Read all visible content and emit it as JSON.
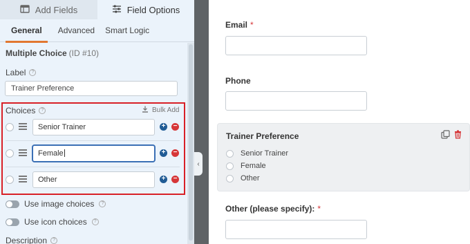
{
  "top_tabs": [
    {
      "label": "Add Fields",
      "icon": "table-icon",
      "active": false
    },
    {
      "label": "Field Options",
      "icon": "sliders-icon",
      "active": true
    }
  ],
  "sub_tabs": [
    {
      "label": "General",
      "active": true
    },
    {
      "label": "Advanced",
      "active": false
    },
    {
      "label": "Smart Logic",
      "active": false
    }
  ],
  "field": {
    "type_name": "Multiple Choice",
    "id_text": "(ID #10)"
  },
  "label_section": {
    "label": "Label",
    "value": "Trainer Preference"
  },
  "choices_section": {
    "label": "Choices",
    "bulk_add": "Bulk Add",
    "items": [
      {
        "value": "Senior Trainer",
        "focused": false
      },
      {
        "value": "Female",
        "focused": true
      },
      {
        "value": "Other",
        "focused": false
      }
    ]
  },
  "toggles": [
    {
      "label": "Use image choices",
      "on": false
    },
    {
      "label": "Use icon choices",
      "on": false
    }
  ],
  "description_label": "Description",
  "preview": {
    "email_label": "Email",
    "required_mark": "*",
    "phone_label": "Phone",
    "selected_field": {
      "title": "Trainer Preference",
      "options": [
        "Senior Trainer",
        "Female",
        "Other"
      ]
    },
    "other_label": "Other (please specify):"
  },
  "colors": {
    "accent_orange": "#e27730",
    "highlight_red": "#d81f26",
    "add_blue": "#1f5b95",
    "delete_red": "#d63638",
    "panel_bg": "#ebf3fb",
    "divider_dark": "#5f6366"
  }
}
